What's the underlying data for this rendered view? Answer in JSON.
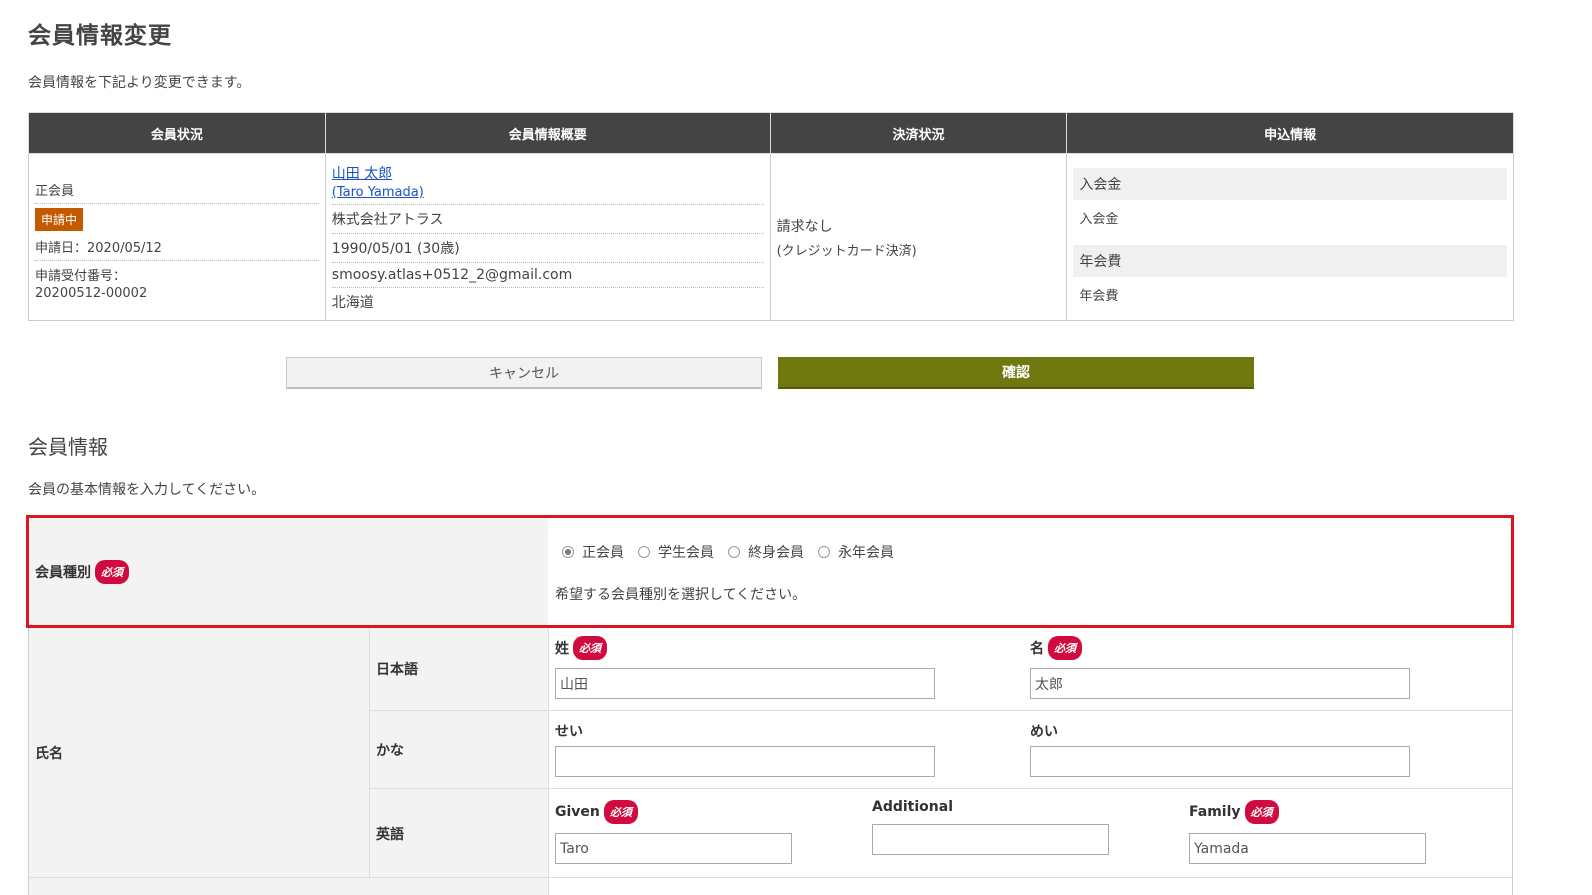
{
  "page": {
    "title": "会員情報変更",
    "intro": "会員情報を下記より変更できます。"
  },
  "summary": {
    "headers": [
      "会員状況",
      "会員情報概要",
      "決済状況",
      "申込情報"
    ],
    "status": {
      "type": "正会員",
      "badge": "申請中",
      "applied_date": "申請日：2020/05/12",
      "receipt_label": "申請受付番号：",
      "receipt_number": "20200512-00002"
    },
    "overview": {
      "name": "山田 太郎",
      "name_en": "(Taro Yamada)",
      "company": "株式会社アトラス",
      "birth": "1990/05/01 (30歳)",
      "email": "smoosy.atlas+0512_2@gmail.com",
      "region": "北海道"
    },
    "payment": {
      "status": "請求なし",
      "method": "(クレジットカード決済)"
    },
    "application": [
      {
        "head": "入会金",
        "value": "入会金"
      },
      {
        "head": "年会費",
        "value": "年会費"
      }
    ]
  },
  "buttons": {
    "cancel": "キャンセル",
    "confirm": "確認"
  },
  "member_section": {
    "title": "会員情報",
    "intro": "会員の基本情報を入力してください。"
  },
  "form": {
    "required": "必須",
    "member_type": {
      "label": "会員種別",
      "options": [
        "正会員",
        "学生会員",
        "終身会員",
        "永年会員"
      ],
      "selected": "正会員",
      "help": "希望する会員種別を選択してください。"
    },
    "name": {
      "label": "氏名",
      "japanese": {
        "label": "日本語",
        "last_label": "姓",
        "last_value": "山田",
        "first_label": "名",
        "first_value": "太郎"
      },
      "kana": {
        "label": "かな",
        "last_label": "せい",
        "last_value": "",
        "first_label": "めい",
        "first_value": ""
      },
      "english": {
        "label": "英語",
        "given_label": "Given",
        "given_value": "Taro",
        "additional_label": "Additional",
        "additional_value": "",
        "family_label": "Family",
        "family_value": "Yamada"
      }
    }
  },
  "colors": {
    "header_bg": "#444444",
    "confirm_bg": "#6e780f",
    "required_badge": "#d10b3f",
    "pending_badge": "#c45a00",
    "highlight_border": "#e0141e",
    "link": "#1a52c4"
  }
}
